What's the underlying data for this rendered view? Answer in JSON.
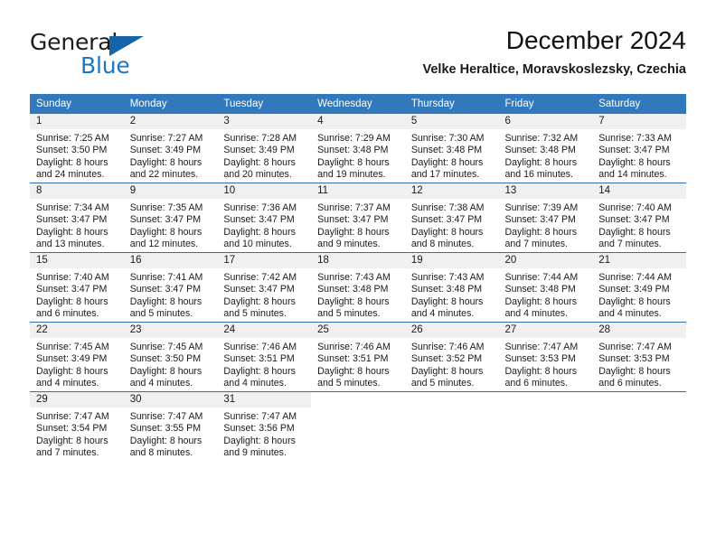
{
  "brand": {
    "name_part1": "General",
    "name_part2": "Blue",
    "logo_icon": "triangle-logo-icon",
    "accent_color": "#1c76c4"
  },
  "header": {
    "title": "December 2024",
    "subtitle": "Velke Heraltice, Moravskoslezsky, Czechia"
  },
  "calendar": {
    "header_bg": "#3179bc",
    "row_divider_color": "#2f6fae",
    "daynum_band_color": "#f0f0f0",
    "weekday_headers": [
      "Sunday",
      "Monday",
      "Tuesday",
      "Wednesday",
      "Thursday",
      "Friday",
      "Saturday"
    ],
    "weeks": [
      [
        {
          "day": "1",
          "sunrise": "Sunrise: 7:25 AM",
          "sunset": "Sunset: 3:50 PM",
          "daylight1": "Daylight: 8 hours",
          "daylight2": "and 24 minutes."
        },
        {
          "day": "2",
          "sunrise": "Sunrise: 7:27 AM",
          "sunset": "Sunset: 3:49 PM",
          "daylight1": "Daylight: 8 hours",
          "daylight2": "and 22 minutes."
        },
        {
          "day": "3",
          "sunrise": "Sunrise: 7:28 AM",
          "sunset": "Sunset: 3:49 PM",
          "daylight1": "Daylight: 8 hours",
          "daylight2": "and 20 minutes."
        },
        {
          "day": "4",
          "sunrise": "Sunrise: 7:29 AM",
          "sunset": "Sunset: 3:48 PM",
          "daylight1": "Daylight: 8 hours",
          "daylight2": "and 19 minutes."
        },
        {
          "day": "5",
          "sunrise": "Sunrise: 7:30 AM",
          "sunset": "Sunset: 3:48 PM",
          "daylight1": "Daylight: 8 hours",
          "daylight2": "and 17 minutes."
        },
        {
          "day": "6",
          "sunrise": "Sunrise: 7:32 AM",
          "sunset": "Sunset: 3:48 PM",
          "daylight1": "Daylight: 8 hours",
          "daylight2": "and 16 minutes."
        },
        {
          "day": "7",
          "sunrise": "Sunrise: 7:33 AM",
          "sunset": "Sunset: 3:47 PM",
          "daylight1": "Daylight: 8 hours",
          "daylight2": "and 14 minutes."
        }
      ],
      [
        {
          "day": "8",
          "sunrise": "Sunrise: 7:34 AM",
          "sunset": "Sunset: 3:47 PM",
          "daylight1": "Daylight: 8 hours",
          "daylight2": "and 13 minutes."
        },
        {
          "day": "9",
          "sunrise": "Sunrise: 7:35 AM",
          "sunset": "Sunset: 3:47 PM",
          "daylight1": "Daylight: 8 hours",
          "daylight2": "and 12 minutes."
        },
        {
          "day": "10",
          "sunrise": "Sunrise: 7:36 AM",
          "sunset": "Sunset: 3:47 PM",
          "daylight1": "Daylight: 8 hours",
          "daylight2": "and 10 minutes."
        },
        {
          "day": "11",
          "sunrise": "Sunrise: 7:37 AM",
          "sunset": "Sunset: 3:47 PM",
          "daylight1": "Daylight: 8 hours",
          "daylight2": "and 9 minutes."
        },
        {
          "day": "12",
          "sunrise": "Sunrise: 7:38 AM",
          "sunset": "Sunset: 3:47 PM",
          "daylight1": "Daylight: 8 hours",
          "daylight2": "and 8 minutes."
        },
        {
          "day": "13",
          "sunrise": "Sunrise: 7:39 AM",
          "sunset": "Sunset: 3:47 PM",
          "daylight1": "Daylight: 8 hours",
          "daylight2": "and 7 minutes."
        },
        {
          "day": "14",
          "sunrise": "Sunrise: 7:40 AM",
          "sunset": "Sunset: 3:47 PM",
          "daylight1": "Daylight: 8 hours",
          "daylight2": "and 7 minutes."
        }
      ],
      [
        {
          "day": "15",
          "sunrise": "Sunrise: 7:40 AM",
          "sunset": "Sunset: 3:47 PM",
          "daylight1": "Daylight: 8 hours",
          "daylight2": "and 6 minutes."
        },
        {
          "day": "16",
          "sunrise": "Sunrise: 7:41 AM",
          "sunset": "Sunset: 3:47 PM",
          "daylight1": "Daylight: 8 hours",
          "daylight2": "and 5 minutes."
        },
        {
          "day": "17",
          "sunrise": "Sunrise: 7:42 AM",
          "sunset": "Sunset: 3:47 PM",
          "daylight1": "Daylight: 8 hours",
          "daylight2": "and 5 minutes."
        },
        {
          "day": "18",
          "sunrise": "Sunrise: 7:43 AM",
          "sunset": "Sunset: 3:48 PM",
          "daylight1": "Daylight: 8 hours",
          "daylight2": "and 5 minutes."
        },
        {
          "day": "19",
          "sunrise": "Sunrise: 7:43 AM",
          "sunset": "Sunset: 3:48 PM",
          "daylight1": "Daylight: 8 hours",
          "daylight2": "and 4 minutes."
        },
        {
          "day": "20",
          "sunrise": "Sunrise: 7:44 AM",
          "sunset": "Sunset: 3:48 PM",
          "daylight1": "Daylight: 8 hours",
          "daylight2": "and 4 minutes."
        },
        {
          "day": "21",
          "sunrise": "Sunrise: 7:44 AM",
          "sunset": "Sunset: 3:49 PM",
          "daylight1": "Daylight: 8 hours",
          "daylight2": "and 4 minutes."
        }
      ],
      [
        {
          "day": "22",
          "sunrise": "Sunrise: 7:45 AM",
          "sunset": "Sunset: 3:49 PM",
          "daylight1": "Daylight: 8 hours",
          "daylight2": "and 4 minutes."
        },
        {
          "day": "23",
          "sunrise": "Sunrise: 7:45 AM",
          "sunset": "Sunset: 3:50 PM",
          "daylight1": "Daylight: 8 hours",
          "daylight2": "and 4 minutes."
        },
        {
          "day": "24",
          "sunrise": "Sunrise: 7:46 AM",
          "sunset": "Sunset: 3:51 PM",
          "daylight1": "Daylight: 8 hours",
          "daylight2": "and 4 minutes."
        },
        {
          "day": "25",
          "sunrise": "Sunrise: 7:46 AM",
          "sunset": "Sunset: 3:51 PM",
          "daylight1": "Daylight: 8 hours",
          "daylight2": "and 5 minutes."
        },
        {
          "day": "26",
          "sunrise": "Sunrise: 7:46 AM",
          "sunset": "Sunset: 3:52 PM",
          "daylight1": "Daylight: 8 hours",
          "daylight2": "and 5 minutes."
        },
        {
          "day": "27",
          "sunrise": "Sunrise: 7:47 AM",
          "sunset": "Sunset: 3:53 PM",
          "daylight1": "Daylight: 8 hours",
          "daylight2": "and 6 minutes."
        },
        {
          "day": "28",
          "sunrise": "Sunrise: 7:47 AM",
          "sunset": "Sunset: 3:53 PM",
          "daylight1": "Daylight: 8 hours",
          "daylight2": "and 6 minutes."
        }
      ],
      [
        {
          "day": "29",
          "sunrise": "Sunrise: 7:47 AM",
          "sunset": "Sunset: 3:54 PM",
          "daylight1": "Daylight: 8 hours",
          "daylight2": "and 7 minutes."
        },
        {
          "day": "30",
          "sunrise": "Sunrise: 7:47 AM",
          "sunset": "Sunset: 3:55 PM",
          "daylight1": "Daylight: 8 hours",
          "daylight2": "and 8 minutes."
        },
        {
          "day": "31",
          "sunrise": "Sunrise: 7:47 AM",
          "sunset": "Sunset: 3:56 PM",
          "daylight1": "Daylight: 8 hours",
          "daylight2": "and 9 minutes."
        },
        {
          "day": "",
          "sunrise": "",
          "sunset": "",
          "daylight1": "",
          "daylight2": "",
          "empty": true
        },
        {
          "day": "",
          "sunrise": "",
          "sunset": "",
          "daylight1": "",
          "daylight2": "",
          "empty": true
        },
        {
          "day": "",
          "sunrise": "",
          "sunset": "",
          "daylight1": "",
          "daylight2": "",
          "empty": true
        },
        {
          "day": "",
          "sunrise": "",
          "sunset": "",
          "daylight1": "",
          "daylight2": "",
          "empty": true
        }
      ]
    ]
  }
}
